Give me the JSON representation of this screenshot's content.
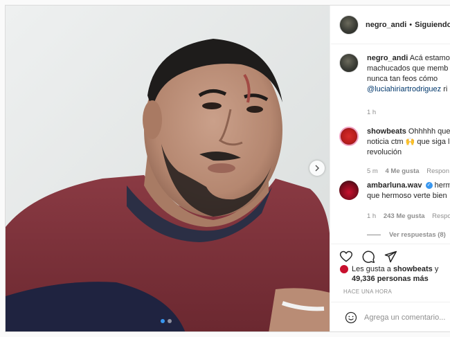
{
  "post": {
    "username": "negro_andi",
    "follow_label": "Siguiendo",
    "caption": {
      "username": "negro_andi",
      "line1": "Acá estamo",
      "line2": "machucados que memb",
      "line3": "nunca tan feos cómo",
      "mention": "@luciahiriartrodriguez",
      "mention_tail": "ri",
      "time": "1 h"
    },
    "comments": [
      {
        "username": "showbeats",
        "line1": "Ohhhhh que",
        "line2": "noticia ctm 🙌 que siga l",
        "line3": "revolución",
        "time": "5 m",
        "likes": "4 Me gusta",
        "reply": "Respon"
      },
      {
        "username": "ambarluna.wav",
        "verified_mark": "✓",
        "line1": "herm",
        "line2": "que hermoso verte bien",
        "time": "1 h",
        "likes": "243 Me gusta",
        "reply": "Respo"
      }
    ],
    "view_replies": "Ver respuestas (8)",
    "likes_prefix": "Les gusta a",
    "likes_user": "showbeats",
    "likes_mid": "y",
    "likes_count": "49,336 personas más",
    "timestamp": "HACE UNA HORA",
    "comment_placeholder": "Agrega un comentario..."
  },
  "media": {
    "active_slide": 1,
    "total_slides": 2
  },
  "icons": {
    "like": "heart-icon",
    "comment": "comment-icon",
    "share": "share-icon",
    "emoji": "emoji-icon",
    "next": "chevron-right-icon"
  },
  "colors": {
    "link": "#00376b",
    "verified": "#3897f0",
    "muted": "#8e8e8e",
    "shirt": "#7a2f38"
  }
}
